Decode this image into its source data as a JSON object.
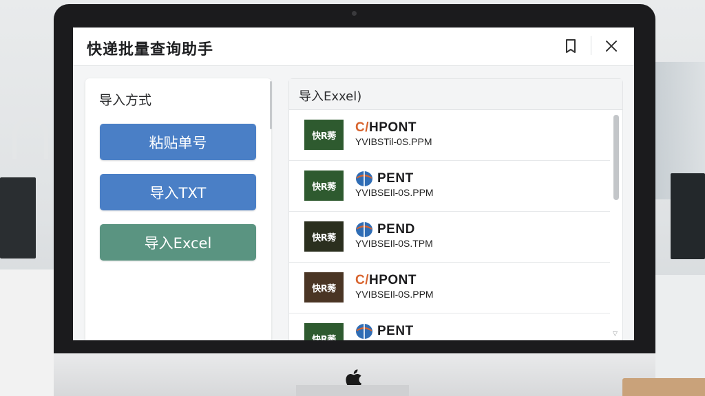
{
  "window": {
    "title": "快递批量查询助手",
    "icons": {
      "bookmark": "bookmark-icon",
      "close": "close-icon"
    }
  },
  "import_panel": {
    "title": "导入方式",
    "buttons": [
      {
        "label": "粘贴单号",
        "color": "#4a7fc6"
      },
      {
        "label": "导入TXT",
        "color": "#4a7fc6"
      },
      {
        "label": "导入Excel",
        "color": "#5a9481"
      }
    ]
  },
  "results_panel": {
    "title": "导入Exxel)",
    "rows": [
      {
        "logo_text": "快R莠",
        "logo_color": "#2e5a2f",
        "brand_icon": "none",
        "brand_prefix": "C/",
        "brand_name": "HPONT",
        "tracking": "YVIBSTil-0S.PPM"
      },
      {
        "logo_text": "快R莠",
        "logo_color": "#2e5a2f",
        "brand_icon": "globe-icon",
        "brand_prefix": "",
        "brand_name": "PENT",
        "tracking": "YVIBSEIl-0S.PPM"
      },
      {
        "logo_text": "快R莠",
        "logo_color": "#2b2f1e",
        "brand_icon": "globe-icon",
        "brand_prefix": "",
        "brand_name": "PEND",
        "tracking": "YVIBSEIl-0S.TPM"
      },
      {
        "logo_text": "快R莠",
        "logo_color": "#4a3524",
        "brand_icon": "none",
        "brand_prefix": "C/",
        "brand_name": "HPONT",
        "tracking": "YVIBSEIl-0S.PPM"
      },
      {
        "logo_text": "快R莠",
        "logo_color": "#2e5a2f",
        "brand_icon": "globe-icon",
        "brand_prefix": "",
        "brand_name": "PENT",
        "tracking": ""
      }
    ]
  },
  "colors": {
    "accent_blue": "#4a7fc6",
    "accent_green": "#5a9481",
    "brand_orange": "#d8642e",
    "globe_blue": "#2f6db5"
  }
}
